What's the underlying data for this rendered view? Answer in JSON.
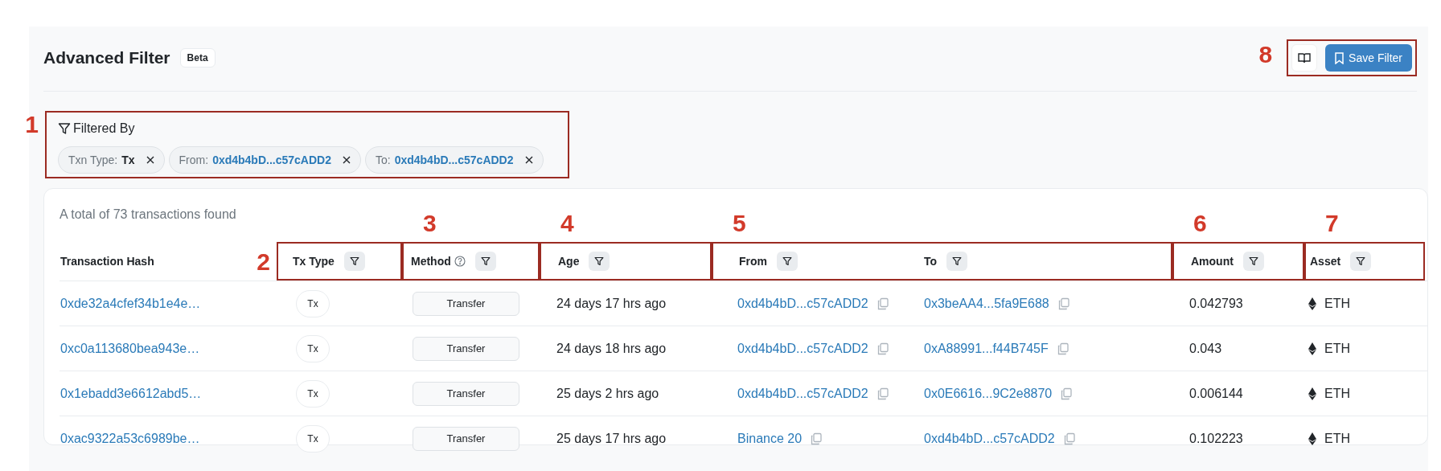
{
  "header": {
    "title": "Advanced Filter",
    "badge": "Beta",
    "save_button": "Save Filter",
    "callout": "8"
  },
  "filters": {
    "title": "Filtered By",
    "callout": "1",
    "chips": [
      {
        "label": "Txn Type:",
        "value": "Tx",
        "kind": "plain"
      },
      {
        "label": "From:",
        "value": "0xd4b4bD...c57cADD2",
        "kind": "address"
      },
      {
        "label": "To:",
        "value": "0xd4b4bD...c57cADD2",
        "kind": "address"
      }
    ]
  },
  "table": {
    "summary": "A total of 73 transactions found",
    "header_groups": [
      {
        "columns": [
          {
            "label": "Transaction Hash"
          }
        ]
      },
      {
        "callout": "2",
        "kind": "side-callout",
        "columns": [
          {
            "label": "Tx Type",
            "filter": true
          }
        ]
      },
      {
        "callout": "3",
        "kind": "top-callout",
        "columns": [
          {
            "label": "Method",
            "filter": true,
            "help": true
          }
        ]
      },
      {
        "callout": "4",
        "kind": "top-callout",
        "columns": [
          {
            "label": "Age",
            "filter": true
          }
        ]
      },
      {
        "callout": "5",
        "kind": "top-callout",
        "columns": [
          {
            "label": "From",
            "filter": true
          },
          {
            "label": "To",
            "filter": true
          }
        ]
      },
      {
        "callout": "6",
        "kind": "top-callout",
        "columns": [
          {
            "label": "Amount",
            "filter": true
          }
        ]
      },
      {
        "callout": "7",
        "kind": "top-callout",
        "columns": [
          {
            "label": "Asset",
            "filter": true
          }
        ]
      }
    ],
    "rows": [
      {
        "hash": "0xde32a4cfef34b1e4e…",
        "type": "Tx",
        "method": "Transfer",
        "age": "24 days 17 hrs ago",
        "from": "0xd4b4bD...c57cADD2",
        "to": "0x3beAA4...5fa9E688",
        "amount": "0.042793",
        "asset": "ETH"
      },
      {
        "hash": "0xc0a113680bea943e…",
        "type": "Tx",
        "method": "Transfer",
        "age": "24 days 18 hrs ago",
        "from": "0xd4b4bD...c57cADD2",
        "to": "0xA88991...f44B745F",
        "amount": "0.043",
        "asset": "ETH"
      },
      {
        "hash": "0x1ebadd3e6612abd5…",
        "type": "Tx",
        "method": "Transfer",
        "age": "25 days 2 hrs ago",
        "from": "0xd4b4bD...c57cADD2",
        "to": "0x0E6616...9C2e8870",
        "amount": "0.006144",
        "asset": "ETH"
      },
      {
        "hash": "0xac9322a53c6989be…",
        "type": "Tx",
        "method": "Transfer",
        "age": "25 days 17 hrs ago",
        "from": "Binance 20",
        "to": "0xd4b4bD...c57cADD2",
        "amount": "0.102223",
        "asset": "ETH"
      }
    ]
  }
}
